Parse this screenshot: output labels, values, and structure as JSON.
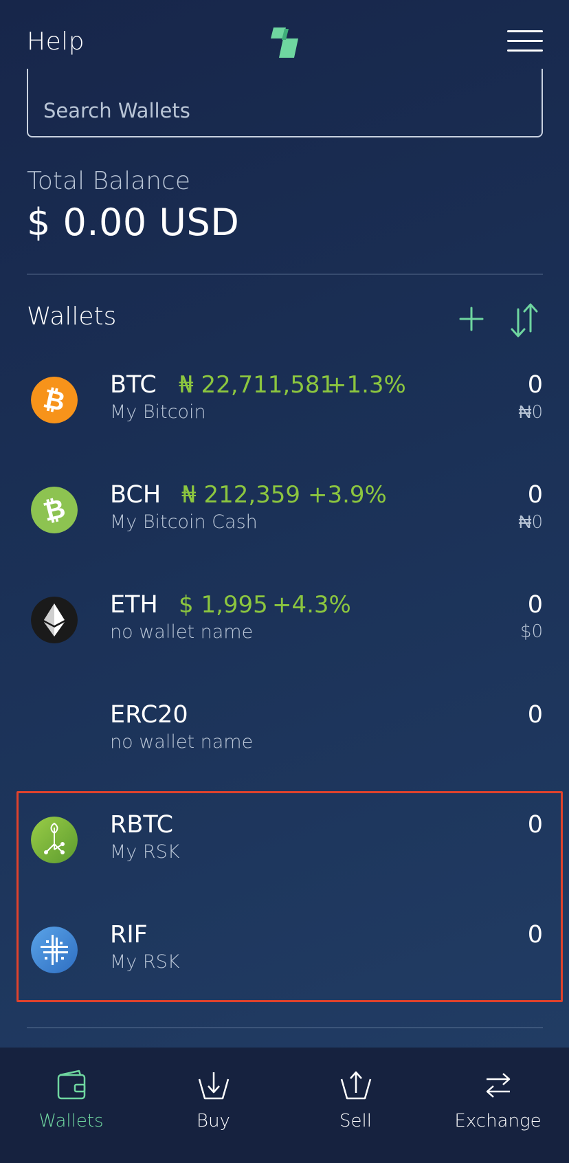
{
  "header": {
    "help_label": "Help",
    "logo_icon": "exodus-logo-icon",
    "menu_icon": "hamburger-menu-icon"
  },
  "search": {
    "placeholder": "Search Wallets",
    "value": ""
  },
  "balance": {
    "label": "Total Balance",
    "value": "$ 0.00 USD"
  },
  "wallets": {
    "title": "Wallets",
    "add_icon": "plus-icon",
    "sort_icon": "sort-arrows-icon",
    "items": [
      {
        "ticker": "BTC",
        "price": "₦ 22,711,581",
        "change": "+1.3%",
        "name": "My Bitcoin",
        "amount": "0",
        "fiat": "₦0",
        "icon": "bitcoin-icon",
        "color": "#f7931a"
      },
      {
        "ticker": "BCH",
        "price": "₦ 212,359",
        "change": "+3.9%",
        "name": "My Bitcoin Cash",
        "amount": "0",
        "fiat": "₦0",
        "icon": "bitcoin-cash-icon",
        "color": "#8dc351"
      },
      {
        "ticker": "ETH",
        "price": "$ 1,995",
        "change": "+4.3%",
        "name": "no wallet name",
        "amount": "0",
        "fiat": "$0",
        "icon": "ethereum-icon",
        "color": "#1a1a1a"
      },
      {
        "ticker": "ERC20",
        "price": "",
        "change": "",
        "name": "no wallet name",
        "amount": "0",
        "fiat": "",
        "icon": "",
        "color": ""
      },
      {
        "ticker": "RBTC",
        "price": "",
        "change": "",
        "name": "My RSK",
        "amount": "0",
        "fiat": "",
        "icon": "rsk-icon",
        "color": "#8dc351"
      },
      {
        "ticker": "RIF",
        "price": "",
        "change": "",
        "name": "My RSK",
        "amount": "0",
        "fiat": "",
        "icon": "rif-icon",
        "color": "#4a90e2"
      }
    ]
  },
  "nav": {
    "items": [
      {
        "label": "Wallets",
        "icon": "wallet-icon",
        "active": true
      },
      {
        "label": "Buy",
        "icon": "buy-icon",
        "active": false
      },
      {
        "label": "Sell",
        "icon": "sell-icon",
        "active": false
      },
      {
        "label": "Exchange",
        "icon": "exchange-icon",
        "active": false
      }
    ]
  },
  "colors": {
    "accent_green": "#6fd6a0",
    "price_green": "#8cc63f",
    "highlight_red": "#e0422c",
    "background": "#1b3157"
  }
}
